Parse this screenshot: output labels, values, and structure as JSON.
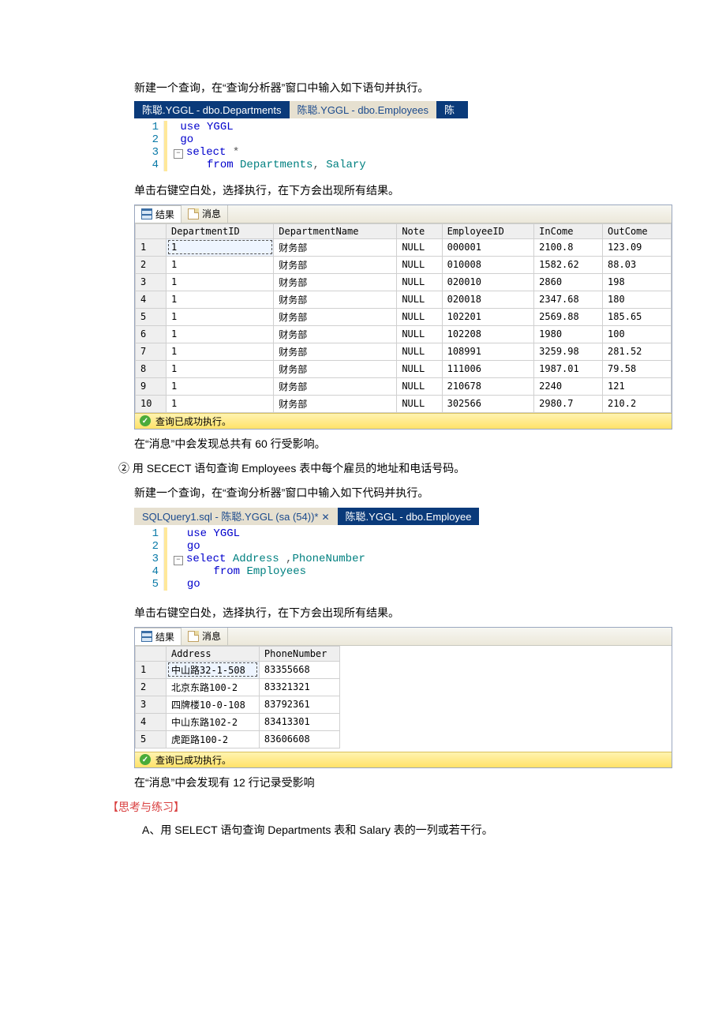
{
  "instr1": "新建一个查询，在“查询分析器”窗口中输入如下语句并执行。",
  "tabs1": {
    "active": "陈聪.YGGL - dbo.Departments",
    "inactive": "陈聪.YGGL - dbo.Employees",
    "stub": "陈"
  },
  "code1": {
    "l1": "use YGGL",
    "l2": "go",
    "l3": "select *",
    "l4": "    from Departments, Salary"
  },
  "instr2": "单击右键空白处，选择执行，在下方会出现所有结果。",
  "resultTabs": {
    "results": "结果",
    "messages": "消息"
  },
  "grid1": {
    "headers": [
      "",
      "DepartmentID",
      "DepartmentName",
      "Note",
      "EmployeeID",
      "InCome",
      "OutCome"
    ],
    "rows": [
      [
        "1",
        "1",
        "财务部",
        "NULL",
        "000001",
        "2100.8",
        "123.09"
      ],
      [
        "2",
        "1",
        "财务部",
        "NULL",
        "010008",
        "1582.62",
        "88.03"
      ],
      [
        "3",
        "1",
        "财务部",
        "NULL",
        "020010",
        "2860",
        "198"
      ],
      [
        "4",
        "1",
        "财务部",
        "NULL",
        "020018",
        "2347.68",
        "180"
      ],
      [
        "5",
        "1",
        "财务部",
        "NULL",
        "102201",
        "2569.88",
        "185.65"
      ],
      [
        "6",
        "1",
        "财务部",
        "NULL",
        "102208",
        "1980",
        "100"
      ],
      [
        "7",
        "1",
        "财务部",
        "NULL",
        "108991",
        "3259.98",
        "281.52"
      ],
      [
        "8",
        "1",
        "财务部",
        "NULL",
        "111006",
        "1987.01",
        "79.58"
      ],
      [
        "9",
        "1",
        "财务部",
        "NULL",
        "210678",
        "2240",
        "121"
      ],
      [
        "10",
        "1",
        "财务部",
        "NULL",
        "302566",
        "2980.7",
        "210.2"
      ]
    ]
  },
  "status_ok": "查询已成功执行。",
  "after1": "在“消息”中会发现总共有 60 行受影响。",
  "step2": "② 用 SECECT 语句查询 Employees 表中每个雇员的地址和电话号码。",
  "step2b": "新建一个查询，在“查询分析器”窗口中输入如下代码并执行。",
  "tabs2": {
    "active": "SQLQuery1.sql - 陈聪.YGGL (sa (54))*",
    "inactive": "陈聪.YGGL - dbo.Employee"
  },
  "code2": {
    "l1": "use YGGL",
    "l2": "go",
    "l3": "select Address ,PhoneNumber",
    "l4": "    from Employees",
    "l5": "go"
  },
  "instr3": "单击右键空白处，选择执行，在下方会出现所有结果。",
  "grid2": {
    "headers": [
      "",
      "Address",
      "PhoneNumber"
    ],
    "rows": [
      [
        "1",
        "中山路32-1-508",
        "83355668"
      ],
      [
        "2",
        "北京东路100-2",
        "83321321"
      ],
      [
        "3",
        "四牌楼10-0-108",
        "83792361"
      ],
      [
        "4",
        "中山东路102-2",
        "83413301"
      ],
      [
        "5",
        "虎距路100-2",
        "83606608"
      ]
    ]
  },
  "after2": "在“消息”中会发现有 12 行记录受影响",
  "think_title": "【思考与练习】",
  "think_a": "A、用 SELECT 语句查询 Departments 表和 Salary 表的一列或若干行。"
}
